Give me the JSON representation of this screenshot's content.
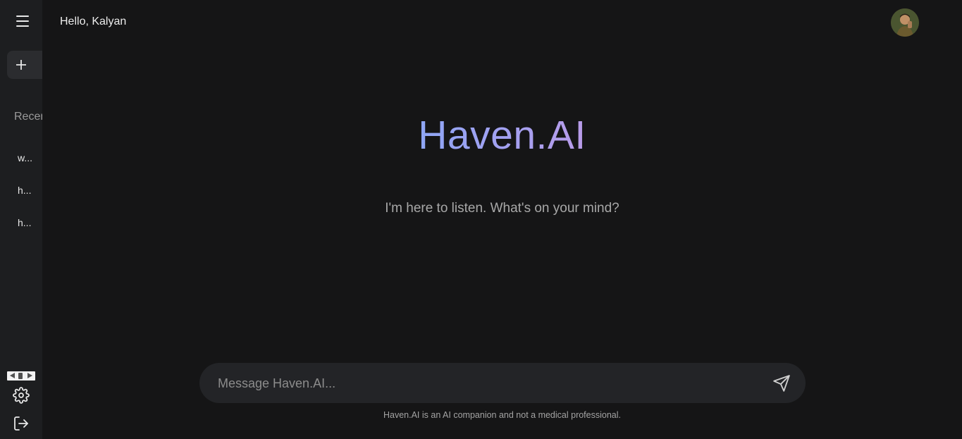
{
  "header": {
    "greeting": "Hello, Kalyan"
  },
  "sidebar": {
    "recent_heading": "Recent",
    "recent_items": [
      {
        "label": "w..."
      },
      {
        "label": "h..."
      },
      {
        "label": "h..."
      }
    ],
    "icons": {
      "menu": "hamburger-menu-icon",
      "new_chat": "plus-icon",
      "settings": "gear-icon",
      "logout": "logout-icon"
    }
  },
  "main": {
    "brand_title": "Haven.AI",
    "tagline": "I'm here to listen. What's on your mind?",
    "composer": {
      "placeholder": "Message Haven.AI...",
      "value": "",
      "send_icon": "send-paper-plane-icon"
    },
    "disclaimer": "Haven.AI is an AI companion and not a medical professional."
  },
  "colors": {
    "background": "#151516",
    "sidebar": "#1d1e20",
    "composer": "#232427",
    "brand_gradient_start": "#8fa6f5",
    "brand_gradient_end": "#b99be8"
  }
}
